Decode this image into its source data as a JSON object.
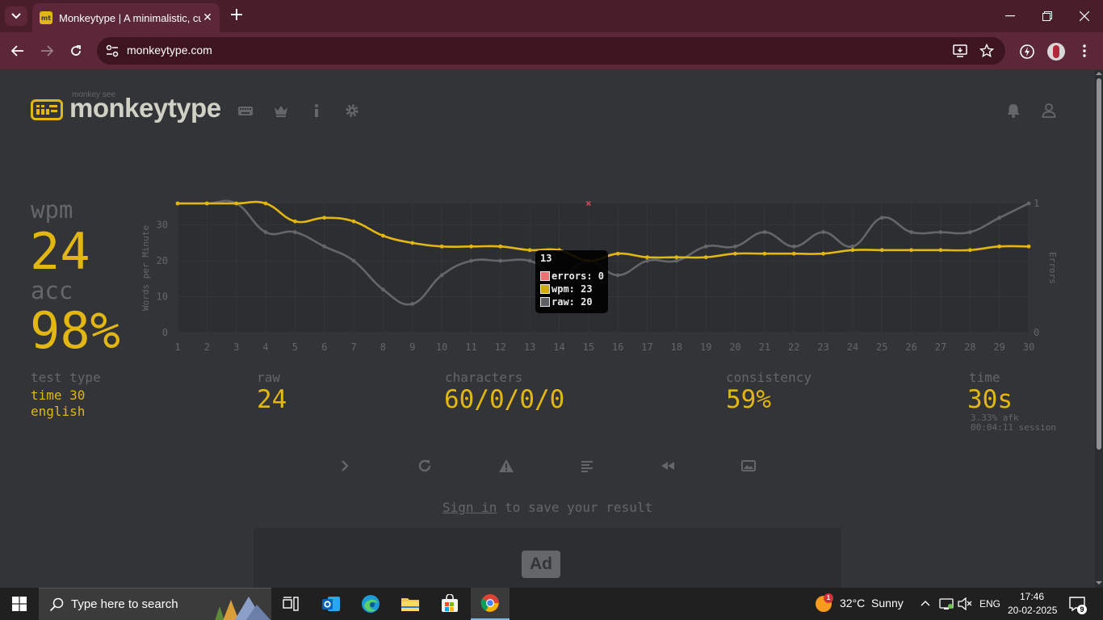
{
  "browser": {
    "tab_title": "Monkeytype | A minimalistic, customizable typing test",
    "tab_favicon_text": "mt",
    "url": "monkeytype.com"
  },
  "header": {
    "logo_sub": "monkey see",
    "logo_text": "monkeytype",
    "nav_icons": [
      "keyboard-icon",
      "crown-icon",
      "info-icon",
      "gear-icon"
    ],
    "right_icons": [
      "bell-icon",
      "user-icon"
    ]
  },
  "result": {
    "wpm_label": "wpm",
    "wpm_value": "24",
    "acc_label": "acc",
    "acc_value": "98%",
    "test_type_label": "test type",
    "test_type_lines": [
      "time 30",
      "english"
    ],
    "raw_label": "raw",
    "raw_value": "24",
    "characters_label": "characters",
    "characters_value": "60/0/0/0",
    "consistency_label": "consistency",
    "consistency_value": "59%",
    "time_label": "time",
    "time_value": "30s",
    "afk": "3.33% afk",
    "session": "00:04:11 session"
  },
  "chart_data": {
    "type": "line",
    "x": [
      1,
      2,
      3,
      4,
      5,
      6,
      7,
      8,
      9,
      10,
      11,
      12,
      13,
      14,
      15,
      16,
      17,
      18,
      19,
      20,
      21,
      22,
      23,
      24,
      25,
      26,
      27,
      28,
      29,
      30
    ],
    "ylabel": "Words per Minute",
    "y2label": "Errors",
    "ylim": [
      0,
      36
    ],
    "y_ticks": [
      0,
      10,
      20,
      30
    ],
    "y2lim": [
      0,
      1
    ],
    "y2_ticks": [
      0,
      1
    ],
    "grid": true,
    "series": [
      {
        "name": "wpm",
        "color": "#e2b714",
        "values": [
          36,
          36,
          36,
          36,
          31,
          32,
          31,
          27,
          25,
          24,
          24,
          24,
          23,
          23,
          20,
          22,
          21,
          21,
          21,
          22,
          22,
          22,
          22,
          23,
          23,
          23,
          23,
          23,
          24,
          24
        ]
      },
      {
        "name": "raw",
        "color": "#646669",
        "values": [
          36,
          36,
          36,
          28,
          28,
          24,
          20,
          12,
          8,
          16,
          20,
          20,
          20,
          16,
          20,
          16,
          20,
          20,
          24,
          24,
          28,
          24,
          28,
          24,
          32,
          28,
          28,
          28,
          32,
          36
        ]
      },
      {
        "name": "errors",
        "color": "#ca4754",
        "points": [
          {
            "x": 15,
            "y": 1
          }
        ]
      }
    ],
    "tooltip": {
      "title": "13",
      "lines": [
        {
          "label": "errors: 0",
          "color": "#ff7a7a"
        },
        {
          "label": "wpm: 23",
          "color": "#e2b714"
        },
        {
          "label": "raw: 20",
          "color": "#646669"
        }
      ]
    }
  },
  "actions": {
    "icons": [
      "next-test-icon",
      "restart-icon",
      "warning-icon",
      "words-history-icon",
      "replay-icon",
      "screenshot-icon"
    ],
    "signin_link": "Sign in",
    "signin_rest": " to save your result"
  },
  "ad": {
    "label": "Ad"
  },
  "taskbar": {
    "search_placeholder": "Type here to search",
    "weather": "32°C  Sunny",
    "weather_badge": "1",
    "lang": "ENG",
    "time": "17:46",
    "date": "20-02-2025",
    "notifications": "9"
  }
}
